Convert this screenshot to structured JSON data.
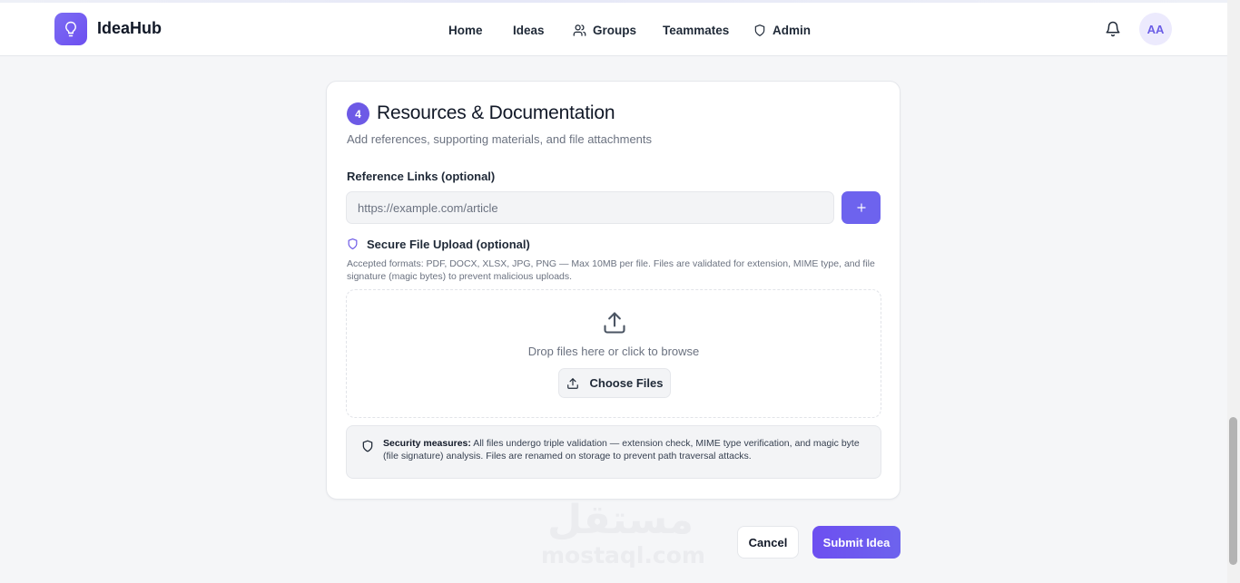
{
  "header": {
    "brand": "IdeaHub",
    "logo_icon": "lightbulb-icon",
    "nav": [
      {
        "label": "Home",
        "icon": ""
      },
      {
        "label": "Ideas",
        "icon": ""
      },
      {
        "label": "Groups",
        "icon": "users-icon"
      },
      {
        "label": "Teammates",
        "icon": ""
      },
      {
        "label": "Admin",
        "icon": "shield-icon"
      }
    ],
    "notification_icon": "bell-icon",
    "avatar_initials": "AA"
  },
  "section": {
    "step": "4",
    "title": "Resources & Documentation",
    "subtitle": "Add references, supporting materials, and file attachments",
    "reference_links": {
      "label": "Reference Links (optional)",
      "placeholder": "https://example.com/article",
      "value": "",
      "add_button": "+"
    },
    "upload": {
      "label": "Secure File Upload (optional)",
      "formats_note": "Accepted formats: PDF, DOCX, XLSX, JPG, PNG — Max 10MB per file. Files are validated for extension, MIME type, and file signature (magic bytes) to prevent malicious uploads.",
      "drop_text": "Drop files here or click to browse",
      "choose_button": "Choose Files"
    },
    "security": {
      "title": "Security measures:",
      "text": " All files undergo triple validation — extension check, MIME type verification, and magic byte (file signature) analysis. Files are renamed on storage to prevent path traversal attacks."
    }
  },
  "actions": {
    "cancel": "Cancel",
    "submit": "Submit Idea"
  },
  "watermark": {
    "arabic": "مستقل",
    "latin": "mostaql.com"
  },
  "colors": {
    "accent": "#6d63ee",
    "accent_dark": "#6d4ff0",
    "page_bg": "#f5f6f8"
  }
}
